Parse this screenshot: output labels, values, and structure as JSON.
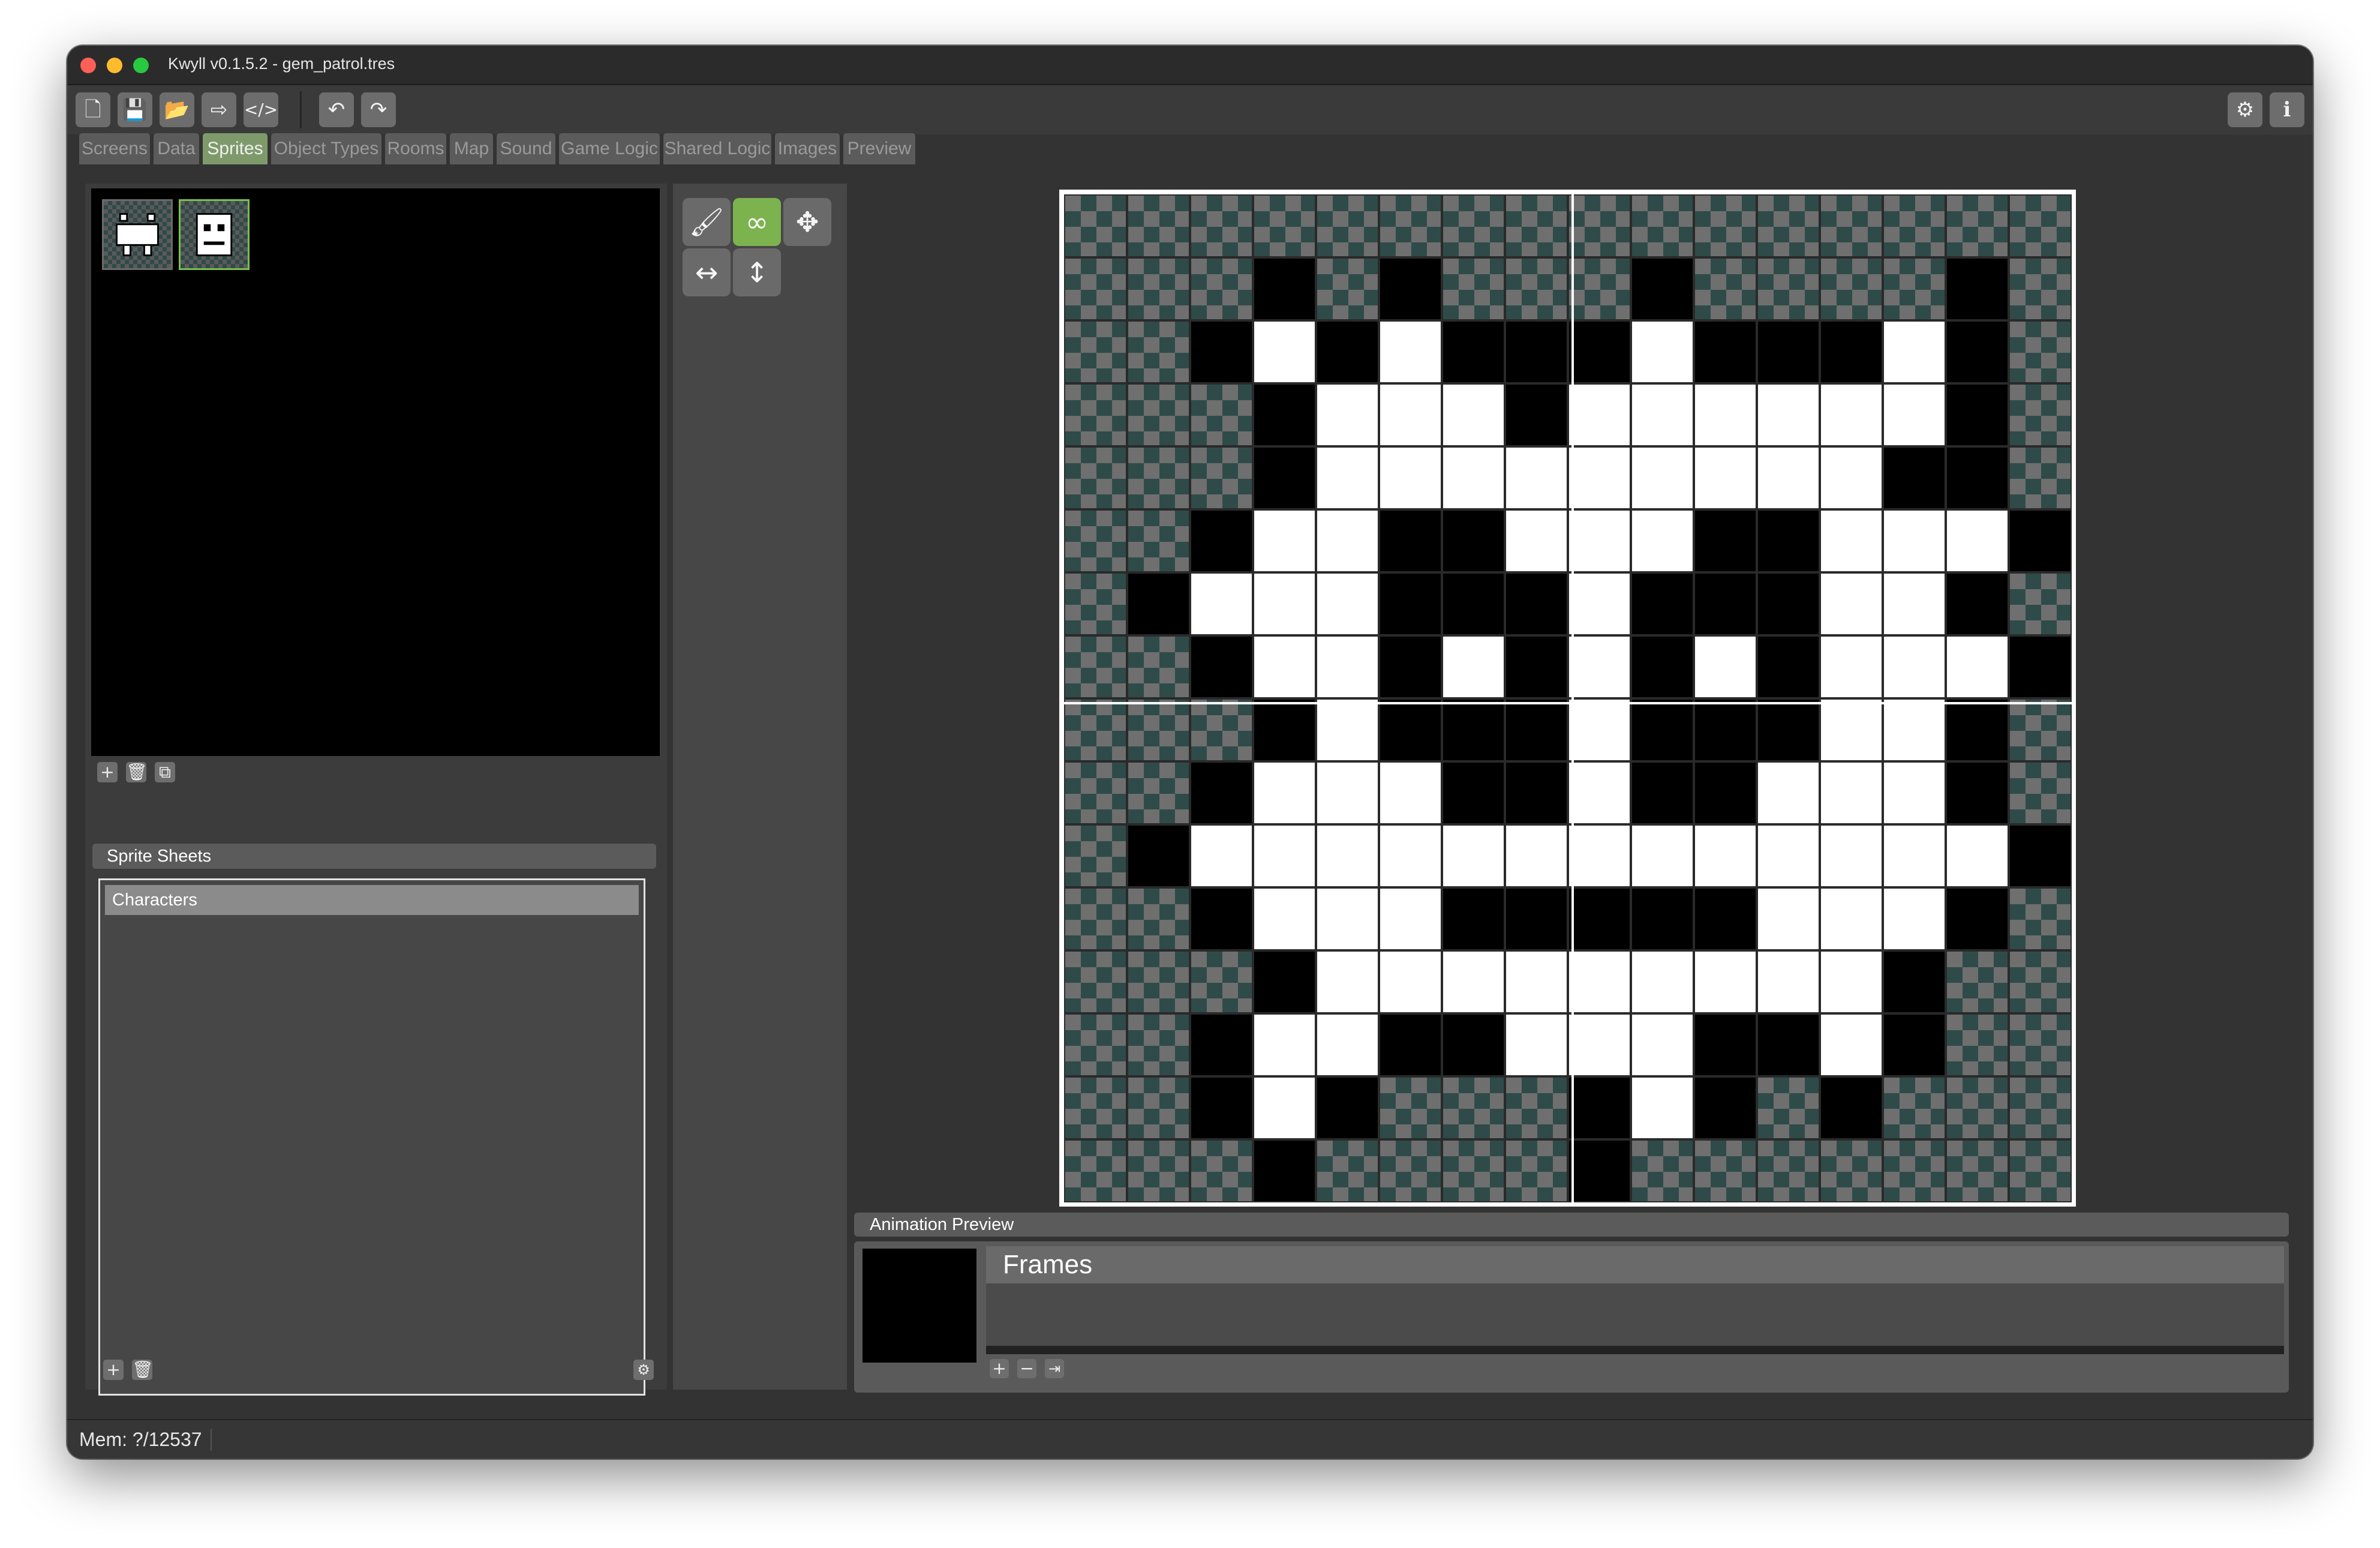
{
  "window": {
    "title": "Kwyll v0.1.5.2 - gem_patrol.tres"
  },
  "toolbar": {
    "left_icons": [
      "new-file-icon",
      "save-icon",
      "open-folder-icon",
      "export-icon",
      "code-icon",
      "undo-icon",
      "redo-icon"
    ],
    "right_icons": [
      "gear-icon",
      "info-icon"
    ]
  },
  "tabs": [
    {
      "label": "Screens"
    },
    {
      "label": "Data"
    },
    {
      "label": "Sprites",
      "active": true
    },
    {
      "label": "Object Types"
    },
    {
      "label": "Rooms"
    },
    {
      "label": "Map"
    },
    {
      "label": "Sound"
    },
    {
      "label": "Game Logic"
    },
    {
      "label": "Shared Logic"
    },
    {
      "label": "Images"
    },
    {
      "label": "Preview"
    }
  ],
  "sprite_sheets": {
    "header": "Sprite Sheets",
    "items": [
      "Characters"
    ]
  },
  "tools": [
    "paint-roller-icon",
    "mask-icon",
    "move-icon",
    "flip-horizontal-icon",
    "flip-vertical-icon"
  ],
  "pixel_grid": {
    "size": 16,
    "legend": {
      "t": "transparent",
      "k": "black",
      "w": "white"
    },
    "rows": [
      "tttttttttttttttt",
      "tttktktttkttttkt",
      "ttkwkwkkkwkkkwkt",
      "tttkwwwkwwwwwwkt",
      "tttkwwwwwwwwwkkt",
      "ttkwwkkwwwkkwwwk",
      "tkwwwkkkwkkkwwkt",
      "ttkwwkwkwkwkwwwk",
      "tttkwkkkwkkkwwkt",
      "ttkwwwkkwkkwwwkt",
      "tkwwwwwwwwwwwwwk",
      "ttkwwwkkkkkwwwkt",
      "tttkwwwwwwwwwktt",
      "ttkwwkkwwwkkwktt",
      "ttkwktttkwktkttt",
      "tttkttttkttttttt"
    ]
  },
  "animation": {
    "header": "Animation Preview",
    "frames_title": "Frames"
  },
  "status": {
    "memory": "Mem: ?/12537"
  },
  "colors": {
    "accent": "#7cb34f",
    "background": "#333333"
  }
}
